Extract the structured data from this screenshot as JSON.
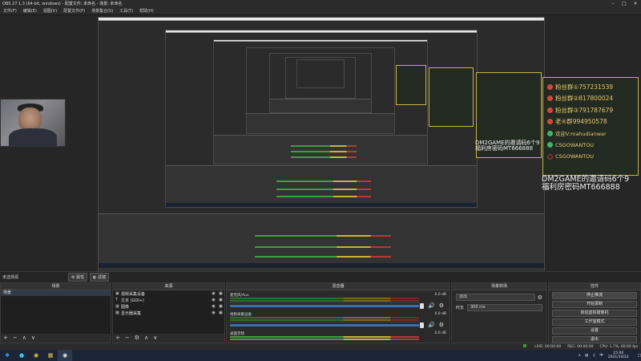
{
  "window": {
    "title": "OBS 27.1.3 (64-bit, windows) - 配置文件: 未命名 - 场景: 未命名",
    "controls": [
      "minimize-icon",
      "maximize-icon",
      "close-icon"
    ]
  },
  "menu": [
    "文件(F)",
    "编辑(E)",
    "视图(V)",
    "配置文件(P)",
    "场景集合(S)",
    "工具(T)",
    "帮助(H)"
  ],
  "overlay": {
    "chat_rows": [
      {
        "icon": "red",
        "text": "粉丝群①757231539"
      },
      {
        "icon": "red",
        "text": "粉丝群②817800024"
      },
      {
        "icon": "red",
        "text": "粉丝群③791787679"
      },
      {
        "icon": "red",
        "text": "老④群994950578"
      },
      {
        "icon": "grn",
        "text": "欢迎V:mahudianwar"
      },
      {
        "icon": "grn",
        "text": "CSGOWANTOU"
      },
      {
        "icon": "dark",
        "text": "CSGOWANTOU"
      }
    ],
    "invite_line1": "DM2GAME的邀请码6个9",
    "invite_line2": "福利房密码MT666888"
  },
  "scene_bar": {
    "label": "未选择源",
    "properties_btn": "属性",
    "filters_btn": "滤镜"
  },
  "scenes": {
    "header": "场景",
    "items": [
      "场景"
    ]
  },
  "sources": {
    "header": "来源",
    "items": [
      {
        "icon": "camera-icon",
        "name": "视频采集设备"
      },
      {
        "icon": "text-icon",
        "name": "文本 (GDI+)"
      },
      {
        "icon": "image-icon",
        "name": "图像"
      },
      {
        "icon": "monitor-icon",
        "name": "显示器采集"
      }
    ]
  },
  "mixer": {
    "header": "混音器",
    "channels": [
      {
        "name": "麦克风/Aux",
        "db": "0.0 dB"
      },
      {
        "name": "视频采集设备",
        "db": "0.0 dB"
      },
      {
        "name": "桌面音频",
        "db": "0.0 dB"
      }
    ]
  },
  "transitions": {
    "header": "场景转场",
    "type": "淡出",
    "duration_label": "时长",
    "duration_value": "300 ms"
  },
  "controls": {
    "header": "控件",
    "buttons": [
      "停止推流",
      "开始录制",
      "启动虚拟摄像机",
      "工作室模式",
      "设置",
      "退出"
    ]
  },
  "status": {
    "live": "LIVE: 00:00:00",
    "rec": "REC: 00:00:00",
    "cpu": "CPU: 1.7%, 60.00 fps"
  },
  "taskbar": {
    "time": "15:00",
    "date": "2021/10/22",
    "lang": "中"
  },
  "colors": {
    "accent_blue": "#3a6fb0",
    "chat_border": "#c6b34a",
    "chat_text": "#e6c86a"
  }
}
